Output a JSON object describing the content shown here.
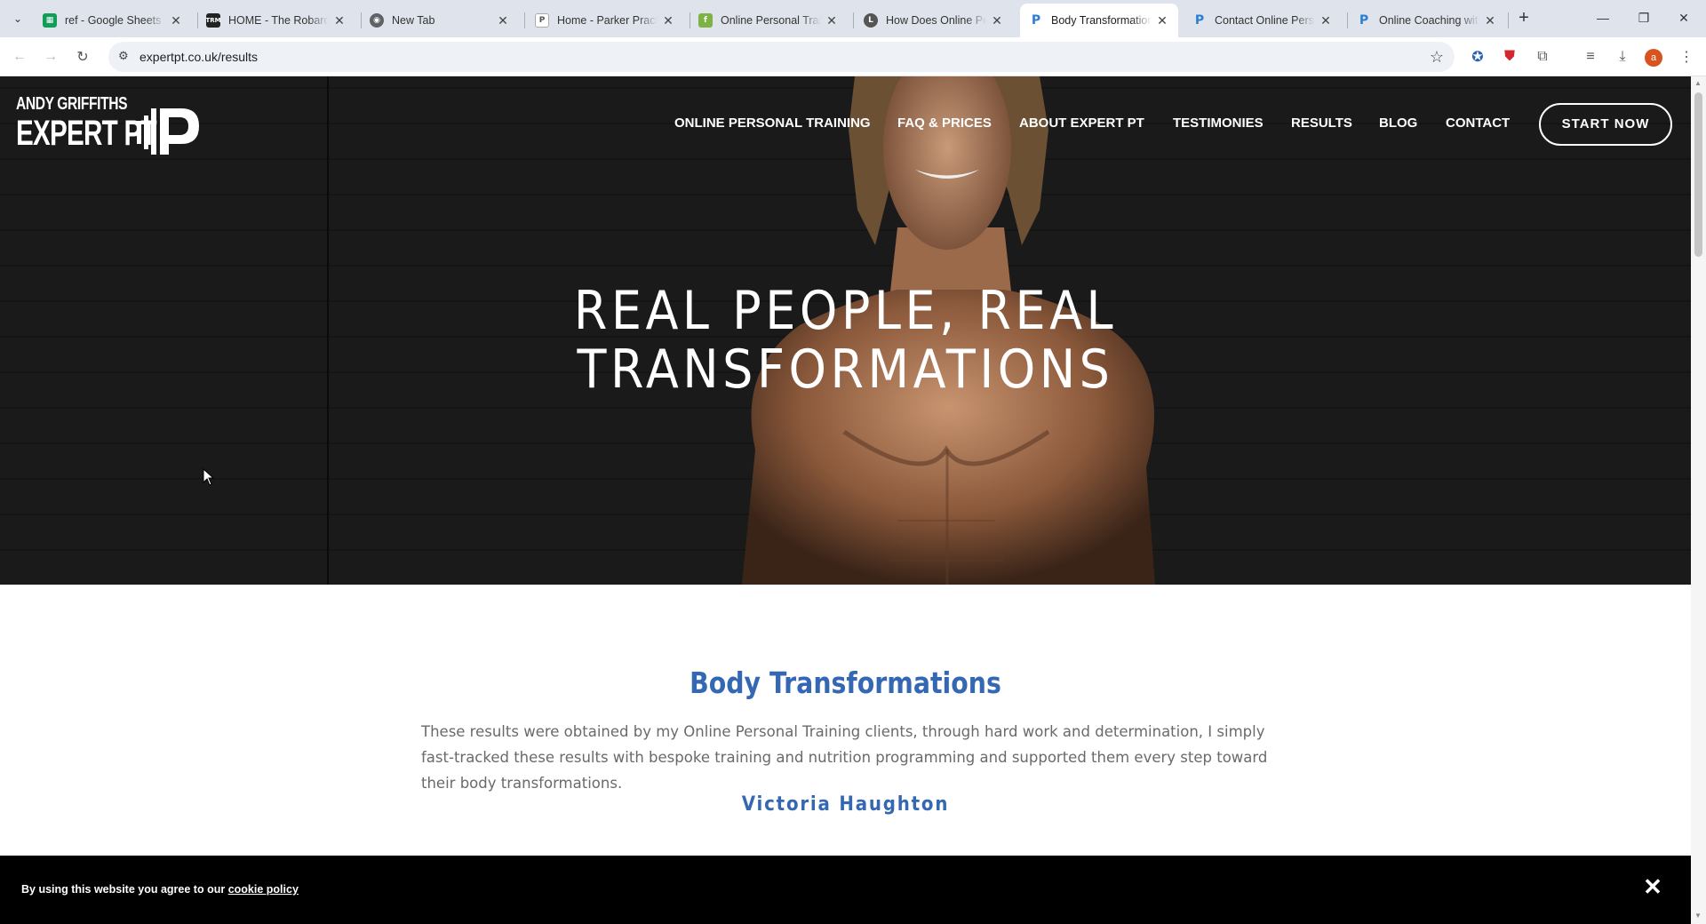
{
  "browser": {
    "tabs": [
      {
        "title": "ref - Google Sheets",
        "favicon": "sheets-icon",
        "color": "#0f9d58",
        "active": false
      },
      {
        "title": "HOME - The Robards",
        "favicon": "trm-icon",
        "color": "#222222",
        "active": false
      },
      {
        "title": "New Tab",
        "favicon": "chrome-icon",
        "color": "#5f6368",
        "active": false
      },
      {
        "title": "Home - Parker Practice",
        "favicon": "parker-icon",
        "color": "#777777",
        "active": false
      },
      {
        "title": "Online Personal Training",
        "favicon": "leaf-icon",
        "color": "#7cb342",
        "active": false
      },
      {
        "title": "How Does Online Personal",
        "favicon": "l-icon",
        "color": "#555555",
        "active": false
      },
      {
        "title": "Body Transformations",
        "favicon": "expertpt-icon",
        "color": "#2a7fd4",
        "active": true
      },
      {
        "title": "Contact Online Personal",
        "favicon": "expertpt-icon",
        "color": "#2a7fd4",
        "active": false
      },
      {
        "title": "Online Coaching with",
        "favicon": "expertpt-icon",
        "color": "#2a7fd4",
        "active": false
      }
    ],
    "url": "expertpt.co.uk/results",
    "profile_initial": "a"
  },
  "site": {
    "logo_line1": "ANDY GRIFFITHS",
    "logo_line2": "EXPERT PT",
    "nav": [
      "ONLINE PERSONAL TRAINING",
      "FAQ & PRICES",
      "ABOUT EXPERT PT",
      "TESTIMONIES",
      "RESULTS",
      "BLOG",
      "CONTACT"
    ],
    "cta": "START NOW",
    "hero_title": "REAL PEOPLE, REAL TRANSFORMATIONS",
    "section_title": "Body Transformations",
    "intro": "These results were obtained by my Online Personal Training clients, through hard work and determination, I simply fast-tracked these results with bespoke training and nutrition programming and supported them every step toward their body transformations.",
    "client_name": "Victoria Haughton",
    "accent_color": "#3568b3"
  },
  "cookie_banner": {
    "text": "By using this website you agree to our",
    "link": "cookie policy",
    "close": "✕"
  }
}
